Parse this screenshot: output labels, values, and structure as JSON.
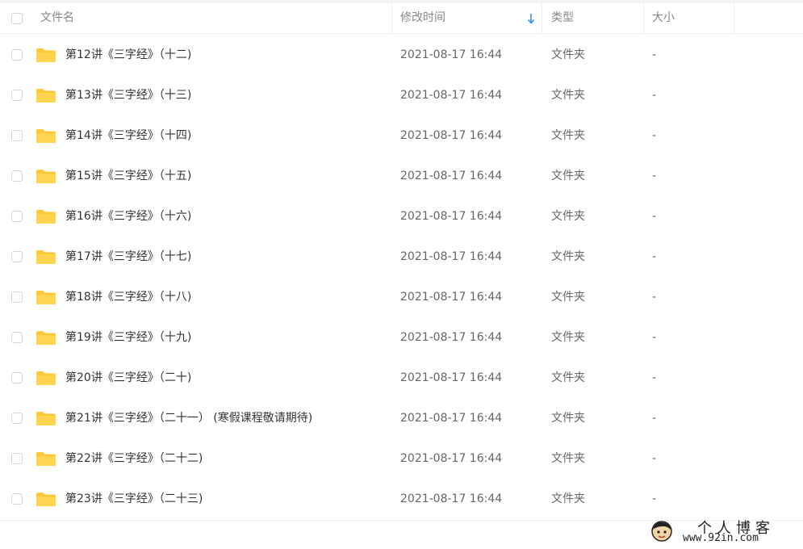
{
  "header": {
    "name": "文件名",
    "modified": "修改时间",
    "type": "类型",
    "size": "大小"
  },
  "colors": {
    "folder": "#ffc933",
    "sort_arrow": "#3b8cff"
  },
  "files": [
    {
      "name": "第12讲《三字经》（十二)",
      "modified": "2021-08-17 16:44",
      "type": "文件夹",
      "size": "-"
    },
    {
      "name": "第13讲《三字经》（十三)",
      "modified": "2021-08-17 16:44",
      "type": "文件夹",
      "size": "-"
    },
    {
      "name": "第14讲《三字经》（十四)",
      "modified": "2021-08-17 16:44",
      "type": "文件夹",
      "size": "-"
    },
    {
      "name": "第15讲《三字经》（十五)",
      "modified": "2021-08-17 16:44",
      "type": "文件夹",
      "size": "-"
    },
    {
      "name": "第16讲《三字经》（十六)",
      "modified": "2021-08-17 16:44",
      "type": "文件夹",
      "size": "-"
    },
    {
      "name": "第17讲《三字经》（十七)",
      "modified": "2021-08-17 16:44",
      "type": "文件夹",
      "size": "-"
    },
    {
      "name": "第18讲《三字经》（十八)",
      "modified": "2021-08-17 16:44",
      "type": "文件夹",
      "size": "-"
    },
    {
      "name": "第19讲《三字经》（十九)",
      "modified": "2021-08-17 16:44",
      "type": "文件夹",
      "size": "-"
    },
    {
      "name": "第20讲《三字经》（二十)",
      "modified": "2021-08-17 16:44",
      "type": "文件夹",
      "size": "-"
    },
    {
      "name": "第21讲《三字经》（二十一） (寒假课程敬请期待)",
      "modified": "2021-08-17 16:44",
      "type": "文件夹",
      "size": "-"
    },
    {
      "name": "第22讲《三字经》（二十二)",
      "modified": "2021-08-17 16:44",
      "type": "文件夹",
      "size": "-"
    },
    {
      "name": "第23讲《三字经》（二十三)",
      "modified": "2021-08-17 16:44",
      "type": "文件夹",
      "size": "-"
    }
  ],
  "watermark": {
    "title": "个人博客",
    "url": "www.92in.com"
  }
}
